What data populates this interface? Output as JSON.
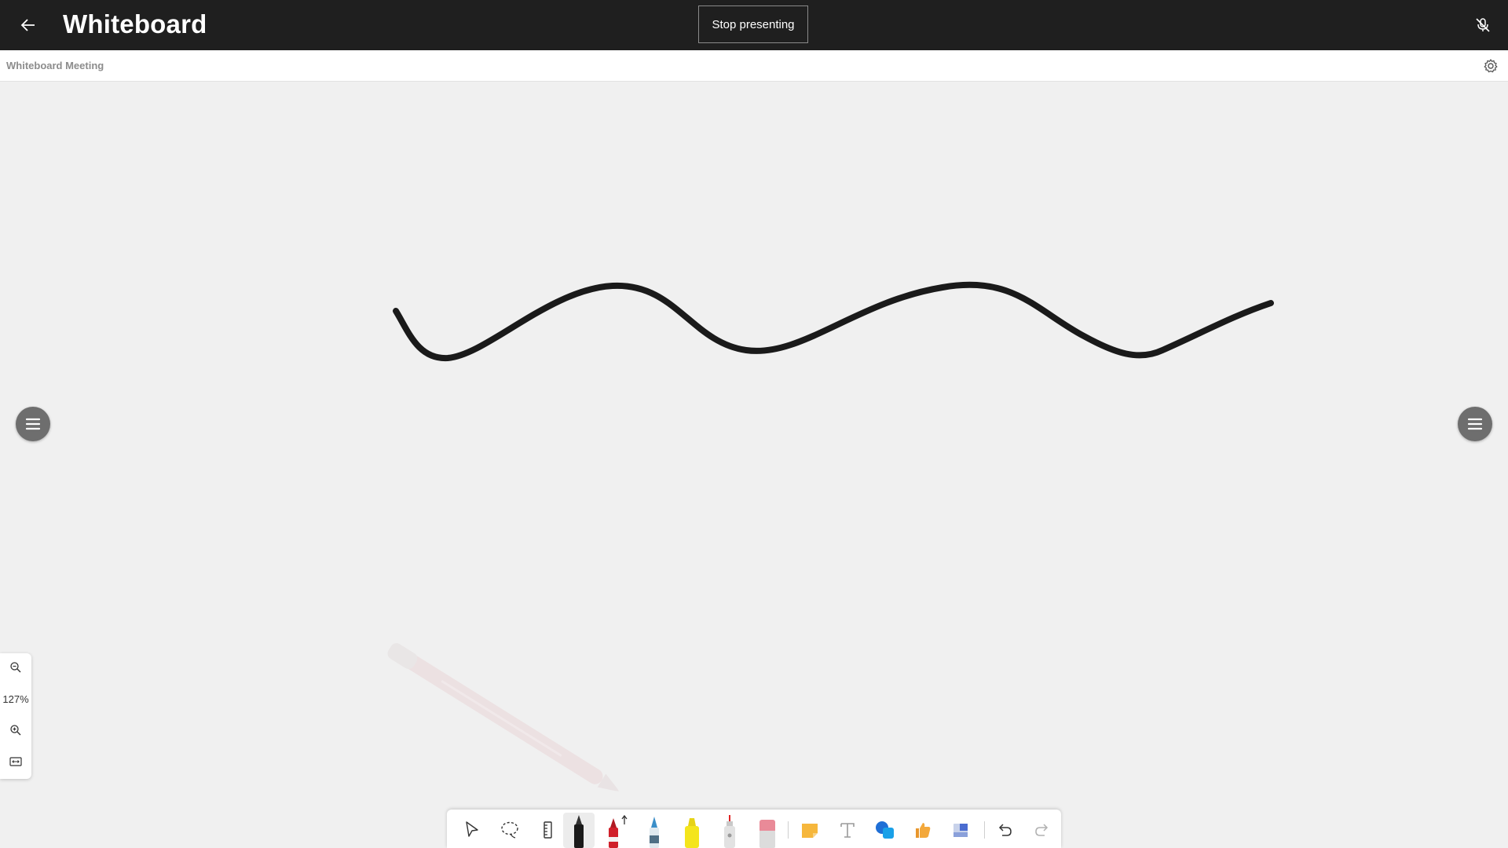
{
  "header": {
    "title": "Whiteboard",
    "stop_presenting_label": "Stop presenting",
    "back_icon": "arrow-left-icon",
    "mic_icon": "mic-off-icon"
  },
  "subheader": {
    "meeting_name": "Whiteboard Meeting",
    "settings_icon": "gear-icon"
  },
  "zoom": {
    "level": "127%",
    "zoom_out_icon": "zoom-out-icon",
    "zoom_in_icon": "zoom-in-icon",
    "fit_icon": "fit-to-screen-icon"
  },
  "colors": {
    "topbar": "#1f1f1f",
    "canvas": "#f0f0f0",
    "ink": "#1a1a1a",
    "side_menu": "#6e6e6e"
  },
  "toolbar": {
    "tools": [
      {
        "name": "select-tool",
        "icon": "pointer-icon"
      },
      {
        "name": "lasso-tool",
        "icon": "lasso-icon"
      },
      {
        "name": "ruler-tool",
        "icon": "ruler-icon"
      },
      {
        "name": "black-pen-tool",
        "icon": "pen-icon",
        "color": "#1a1a1a",
        "active": true
      },
      {
        "name": "red-pen-tool",
        "icon": "pen-icon",
        "color": "#d0202a"
      },
      {
        "name": "blue-pen-tool",
        "icon": "pen-icon",
        "color": "#3a8ec8"
      },
      {
        "name": "highlighter-tool",
        "icon": "highlighter-icon",
        "color": "#f4e51c"
      },
      {
        "name": "laser-pointer-tool",
        "icon": "laser-pointer-icon"
      },
      {
        "name": "eraser-tool",
        "icon": "eraser-icon",
        "color": "#e98a98"
      },
      {
        "name": "sticky-note-tool",
        "icon": "sticky-note-icon",
        "color": "#f6b73c"
      },
      {
        "name": "text-tool",
        "icon": "text-icon"
      },
      {
        "name": "shapes-tool",
        "icon": "shapes-icon",
        "color": "#1f6fd6"
      },
      {
        "name": "reactions-tool",
        "icon": "thumbs-up-icon",
        "color": "#f3a83b"
      },
      {
        "name": "templates-tool",
        "icon": "template-icon",
        "color": "#4a6cd0"
      },
      {
        "name": "undo-button",
        "icon": "undo-icon"
      },
      {
        "name": "redo-button",
        "icon": "redo-icon"
      }
    ]
  }
}
